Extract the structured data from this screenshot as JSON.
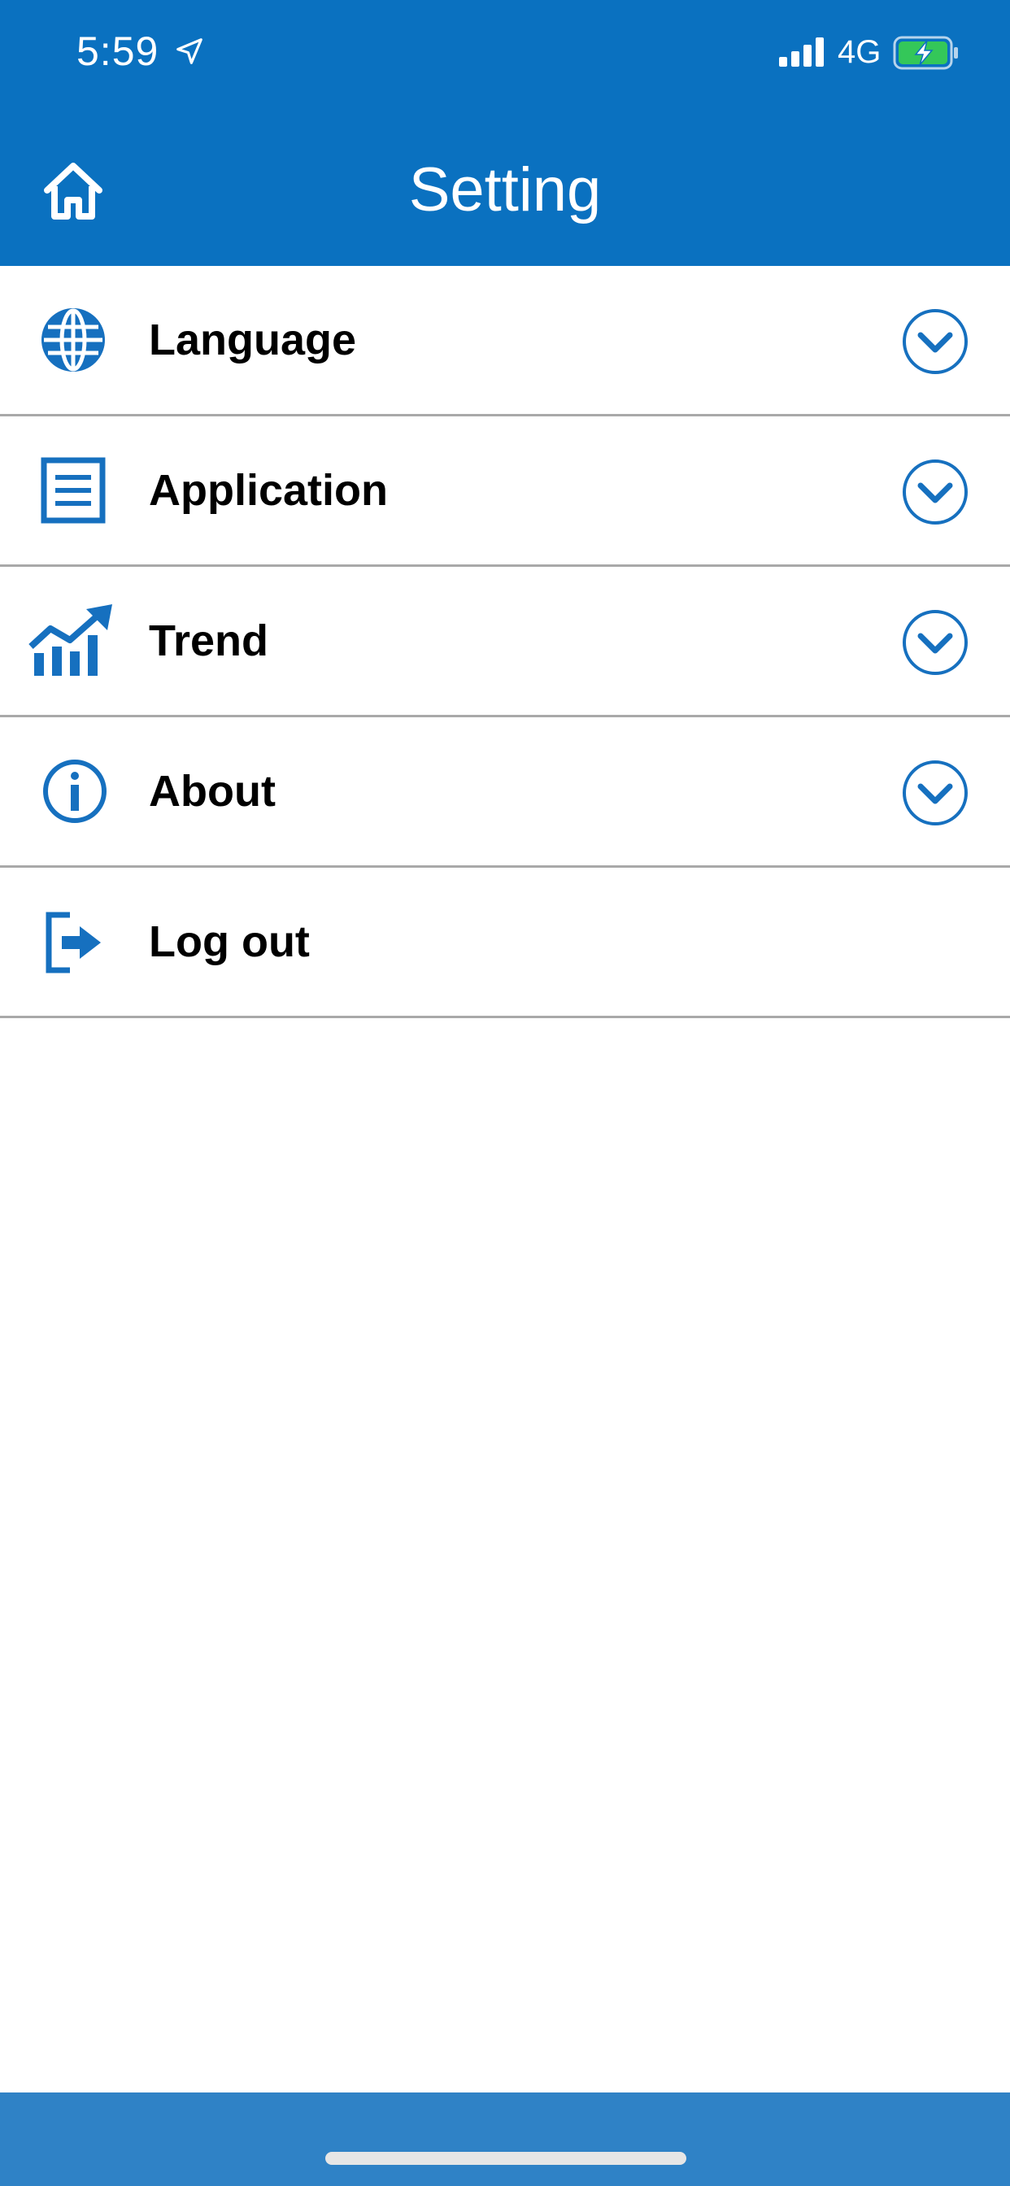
{
  "status_bar": {
    "time": "5:59",
    "network": "4G",
    "icons": [
      "location-arrow-icon",
      "signal-bars-icon",
      "battery-charging-icon"
    ]
  },
  "nav_bar": {
    "title": "Setting",
    "home_icon": "home-icon"
  },
  "settings": {
    "items": [
      {
        "label": "Language",
        "icon": "globe-icon",
        "expandable": true
      },
      {
        "label": "Application",
        "icon": "document-list-icon",
        "expandable": true
      },
      {
        "label": "Trend",
        "icon": "trend-chart-icon",
        "expandable": true
      },
      {
        "label": "About",
        "icon": "info-icon",
        "expandable": true
      },
      {
        "label": "Log out",
        "icon": "logout-icon",
        "expandable": false
      }
    ]
  },
  "colors": {
    "primary": "#0a71c0",
    "bottom_bar": "#2f82c6",
    "divider": "#a9a9a9",
    "icon": "#1670bf",
    "battery_fill": "#34c759"
  }
}
